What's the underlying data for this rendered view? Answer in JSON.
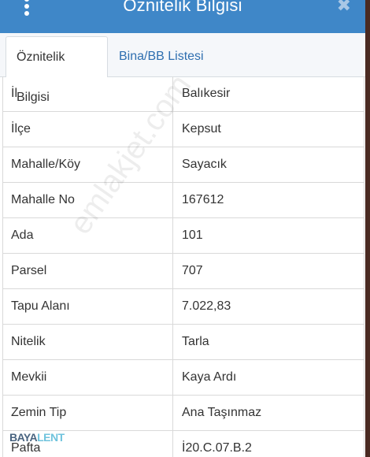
{
  "header": {
    "title": "Öznitelik Bilgisi"
  },
  "tabs": [
    {
      "label": "Öznitelik Bilgisi",
      "active": true
    },
    {
      "label": "Bina/BB Listesi",
      "active": false
    }
  ],
  "rows": [
    {
      "key": "İl",
      "value": "Balıkesir"
    },
    {
      "key": "İlçe",
      "value": "Kepsut"
    },
    {
      "key": "Mahalle/Köy",
      "value": "Sayacık"
    },
    {
      "key": "Mahalle No",
      "value": "167612"
    },
    {
      "key": "Ada",
      "value": "101"
    },
    {
      "key": "Parsel",
      "value": "707"
    },
    {
      "key": "Tapu Alanı",
      "value": "7.022,83"
    },
    {
      "key": "Nitelik",
      "value": "Tarla"
    },
    {
      "key": "Mevkii",
      "value": "Kaya Ardı"
    },
    {
      "key": "Zemin Tip",
      "value": "Ana Taşınmaz"
    },
    {
      "key": "Pafta",
      "value": "İ20.C.07.B.2"
    }
  ],
  "watermark": "emlakjet.com",
  "logo": {
    "part1": "BAYA",
    "part2": "LENT"
  },
  "colors": {
    "header": "#3f87c8",
    "tab_link": "#2f6fb0"
  },
  "icons": {
    "menu": "vertical-dots-icon",
    "close": "close-icon"
  }
}
